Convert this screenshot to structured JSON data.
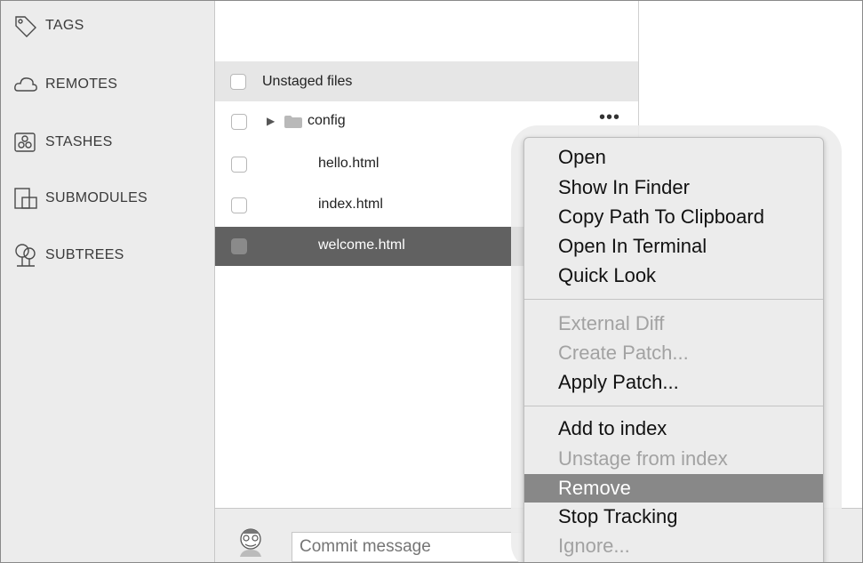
{
  "sidebar": {
    "items": [
      {
        "label": "TAGS",
        "icon": "tag-icon"
      },
      {
        "label": "REMOTES",
        "icon": "cloud-icon"
      },
      {
        "label": "STASHES",
        "icon": "stash-icon"
      },
      {
        "label": "SUBMODULES",
        "icon": "submodule-icon"
      },
      {
        "label": "SUBTREES",
        "icon": "subtree-icon"
      }
    ]
  },
  "files": {
    "header": "Unstaged files",
    "folder": "config",
    "more": "•••",
    "rows": [
      "hello.html",
      "index.html",
      "welcome.html"
    ],
    "selected": "welcome.html"
  },
  "context_menu": {
    "group1": [
      "Open",
      "Show In Finder",
      "Copy Path To Clipboard",
      "Open In Terminal",
      "Quick Look"
    ],
    "group2": [
      {
        "label": "External Diff",
        "enabled": false
      },
      {
        "label": "Create Patch...",
        "enabled": false
      },
      {
        "label": "Apply Patch...",
        "enabled": true
      }
    ],
    "group3": [
      {
        "label": "Add to index",
        "enabled": true
      },
      {
        "label": "Unstage from index",
        "enabled": false
      },
      {
        "label": "Remove",
        "enabled": true,
        "highlighted": true
      },
      {
        "label": "Stop Tracking",
        "enabled": true
      },
      {
        "label": "Ignore...",
        "enabled": false
      }
    ]
  },
  "commit": {
    "placeholder": "Commit message"
  }
}
